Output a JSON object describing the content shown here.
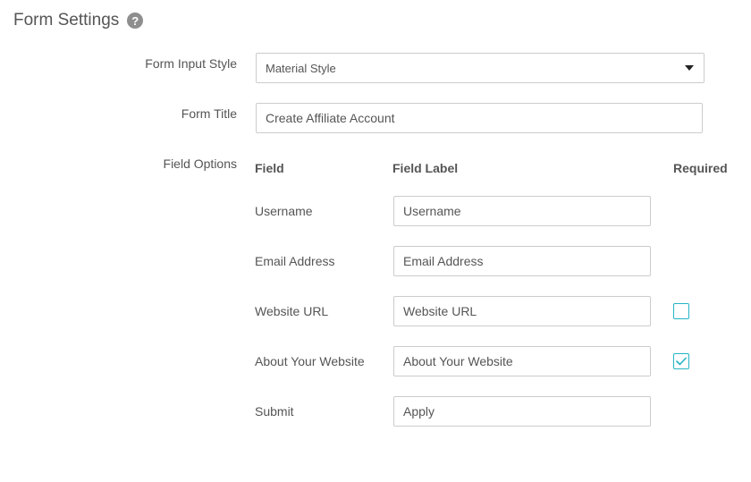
{
  "header": {
    "title": "Form Settings",
    "help_icon": "?"
  },
  "form_input_style": {
    "label": "Form Input Style",
    "selected": "Material Style"
  },
  "form_title": {
    "label": "Form Title",
    "value": "Create Affiliate Account"
  },
  "field_options": {
    "label": "Field Options",
    "columns": {
      "field": "Field",
      "field_label": "Field Label",
      "required": "Required"
    },
    "rows": [
      {
        "field": "Username",
        "label_value": "Username",
        "required": null
      },
      {
        "field": "Email Address",
        "label_value": "Email Address",
        "required": null
      },
      {
        "field": "Website URL",
        "label_value": "Website URL",
        "required": false
      },
      {
        "field": "About Your Website",
        "label_value": "About Your Website",
        "required": true
      },
      {
        "field": "Submit",
        "label_value": "Apply",
        "required": null
      }
    ]
  },
  "colors": {
    "accent": "#26b5c5",
    "text": "#555555",
    "border": "#cccccc"
  }
}
